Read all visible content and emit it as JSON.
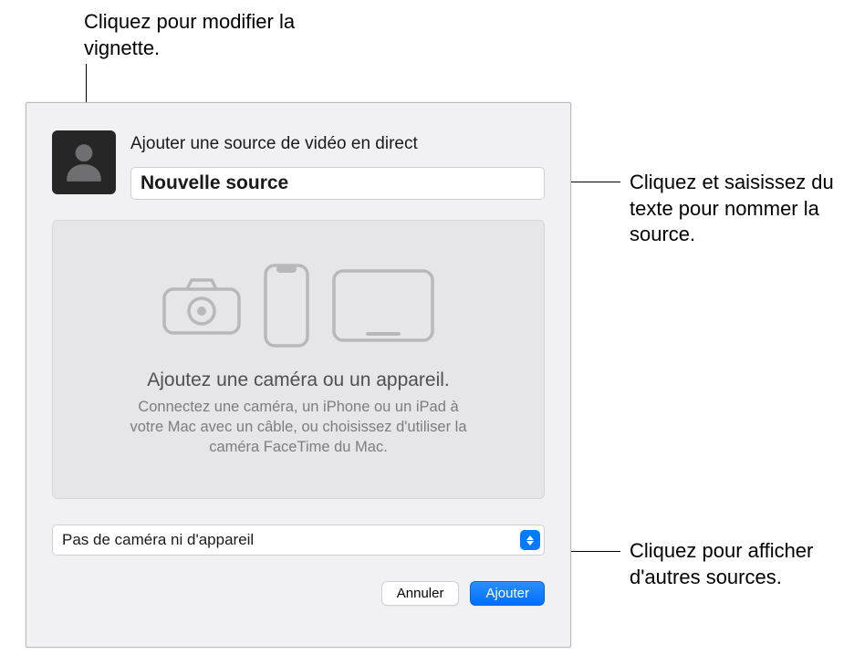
{
  "callouts": {
    "thumbnail": "Cliquez pour modifier la vignette.",
    "name": "Cliquez et saisissez du texte pour nommer la source.",
    "sources": "Cliquez pour afficher d'autres sources."
  },
  "dialog": {
    "title": "Ajouter une source de vidéo en direct",
    "source_name": "Nouvelle source",
    "placeholder_heading": "Ajoutez une caméra ou un appareil.",
    "placeholder_text": "Connectez une caméra, un iPhone ou un iPad à votre Mac avec un câble, ou choisissez d'utiliser la caméra FaceTime du Mac.",
    "device_select_value": "Pas de caméra ni d'appareil",
    "cancel_label": "Annuler",
    "add_label": "Ajouter"
  }
}
